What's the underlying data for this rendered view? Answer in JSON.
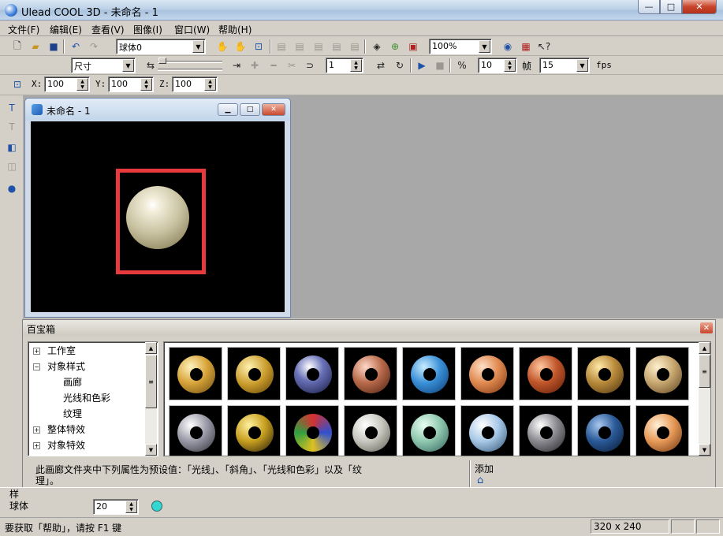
{
  "window": {
    "title": "Ulead COOL 3D - 未命名 - 1",
    "minimize": "—",
    "maximize": "□",
    "close": "✕"
  },
  "menu": [
    "文件(F)",
    "编辑(E)",
    "查看(V)",
    "图像(I)",
    "窗口(W)",
    "帮助(H)"
  ],
  "toolbar1": {
    "object_combo": "球体0",
    "zoom_combo": "100%"
  },
  "toolbar2": {
    "attr_combo": "尺寸",
    "frame_value": "1",
    "percent_value": "10",
    "frame_label": "帧",
    "fps_value": "15",
    "fps_label": "fps"
  },
  "toolbar3": {
    "x_label": "X:",
    "x_value": "100",
    "y_label": "Y:",
    "y_value": "100",
    "z_label": "Z:",
    "z_value": "100"
  },
  "document": {
    "title": "未命名 - 1"
  },
  "panel": {
    "title": "百宝箱",
    "tree": [
      {
        "label": "工作室",
        "toggle": "+"
      },
      {
        "label": "对象样式",
        "toggle": "−"
      },
      {
        "label": "画廊",
        "toggle": ""
      },
      {
        "label": "光线和色彩",
        "toggle": ""
      },
      {
        "label": "纹理",
        "toggle": ""
      },
      {
        "label": "整体特效",
        "toggle": "+"
      },
      {
        "label": "对象特效",
        "toggle": "+"
      }
    ],
    "description_line1": "此画廊文件夹中下列属性为预设值：「光线」、「斜角」、「光线和色彩」以及「纹",
    "description_line2": "理」。",
    "add_label": "添加"
  },
  "objbar": {
    "style_label": "样",
    "object_label": "球体",
    "value": "20"
  },
  "status": {
    "help_text": "要获取「帮助」，请按 F1 键",
    "size": "320 x 240"
  },
  "colors": {
    "selection_rect": "#e8393d",
    "canvas_bg": "#000000",
    "workspace_bg": "#a8a8a8"
  }
}
